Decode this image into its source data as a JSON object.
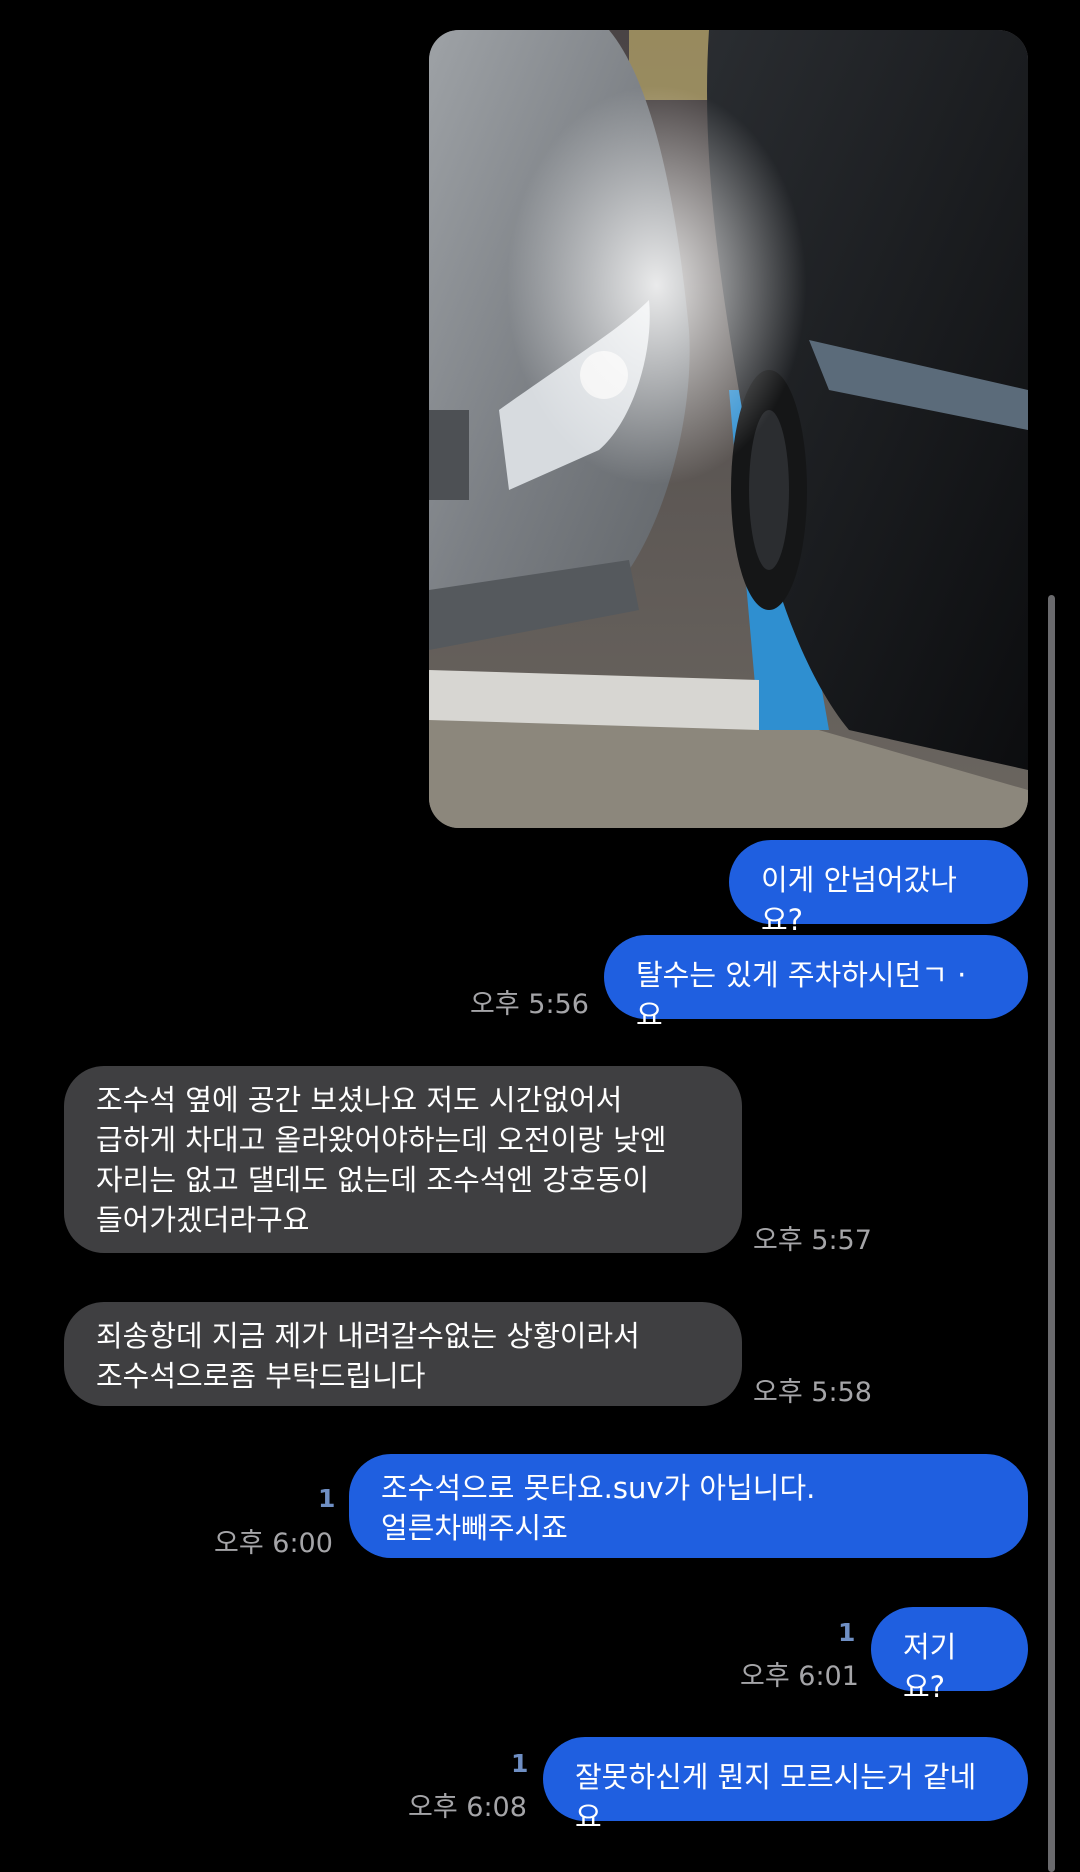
{
  "messages": {
    "m1": {
      "text": "이게 안넘어갔나요?"
    },
    "m2": {
      "text": "탈수는 있게 주차하시던ㄱ · 요",
      "time": "오후 5:56"
    },
    "m3": {
      "text": "조수석 옆에 공간 보셨나요 저도 시간없어서\n급하게 차대고 올라왔어야하는데 오전이랑 낮엔\n자리는 없고 댈데도 없는데 조수석엔 강호동이\n들어가겠더라구요",
      "time": "오후 5:57"
    },
    "m4": {
      "text": "죄송항데 지금 제가 내려갈수없는 상황이라서\n조수석으로좀 부탁드립니다",
      "time": "오후 5:58"
    },
    "m5": {
      "text": "조수석으로 못타요.suv가 아닙니다.\n얼른차빼주시죠",
      "time": "오후 6:00",
      "unread": "1"
    },
    "m6": {
      "text": "저기요?",
      "time": "오후 6:01",
      "unread": "1"
    },
    "m7": {
      "text": "잘못하신게 뭔지 모르시는거 같네요",
      "time": "오후 6:08",
      "unread": "1"
    }
  },
  "colors": {
    "outgoing_bubble": "#1f5fe0",
    "incoming_bubble": "#3f3f41",
    "timestamp": "#a5a5a8",
    "unread_count": "#6f8fc4",
    "background": "#000000"
  }
}
